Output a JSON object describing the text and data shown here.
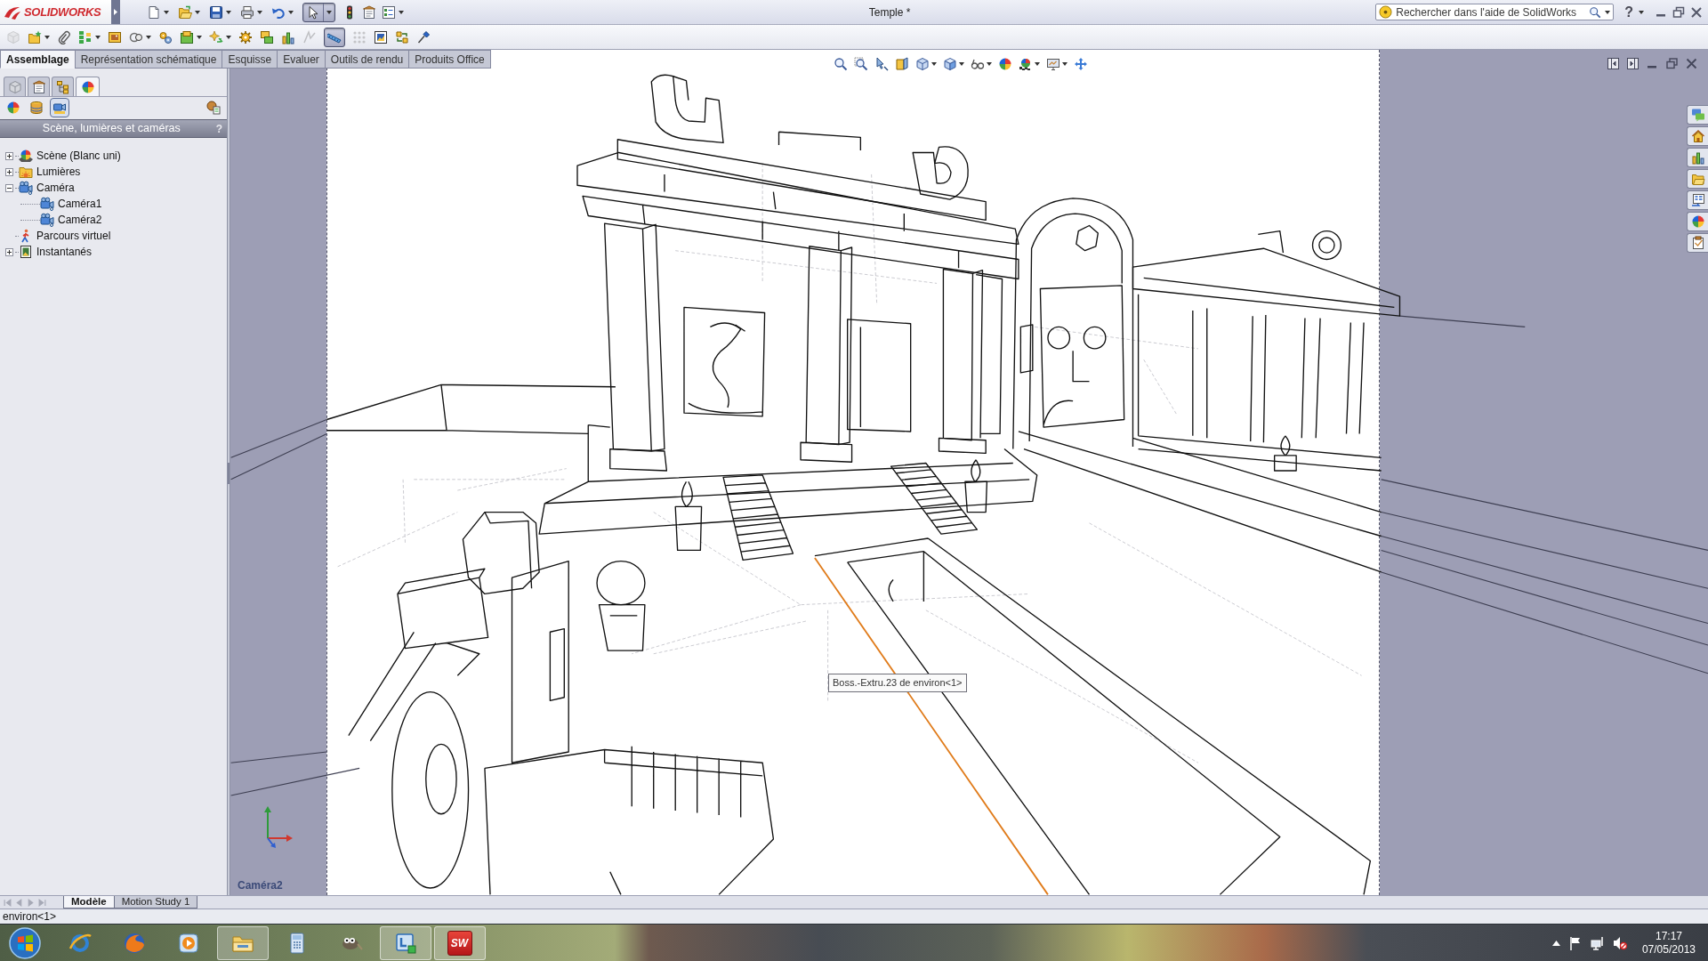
{
  "app": {
    "logo": "SOLIDWORKS",
    "title": "Temple *",
    "search": {
      "placeholder": "Rechercher dans l'aide de SolidWorks"
    },
    "help": "?"
  },
  "quick_access": [
    {
      "pressed": false
    },
    {
      "pressed": false
    },
    {
      "pressed": false
    },
    {
      "pressed": false
    },
    {
      "pressed": false
    },
    {
      "pressed": true
    },
    {
      "pressed": false
    },
    {
      "pressed": false
    },
    {
      "pressed": false
    }
  ],
  "command_toolbar": [
    {
      "disabled": true,
      "pressed": false
    },
    {
      "disabled": false,
      "pressed": false
    },
    {
      "disabled": false,
      "pressed": false
    },
    {
      "disabled": false,
      "pressed": false
    },
    {
      "disabled": false,
      "pressed": false
    },
    {
      "disabled": false,
      "pressed": false
    },
    {
      "disabled": false,
      "pressed": false
    },
    {
      "disabled": false,
      "pressed": false
    },
    {
      "disabled": false,
      "pressed": false
    },
    {
      "disabled": false,
      "pressed": false
    },
    {
      "disabled": false,
      "pressed": false
    },
    {
      "disabled": false,
      "pressed": false
    },
    {
      "disabled": true,
      "pressed": false
    },
    {
      "disabled": false,
      "pressed": true
    },
    {
      "disabled": true,
      "pressed": false
    },
    {
      "disabled": false,
      "pressed": false
    },
    {
      "disabled": false,
      "pressed": false
    },
    {
      "disabled": false,
      "pressed": false
    }
  ],
  "command_tabs": [
    {
      "label": "Assemblage",
      "selected": true
    },
    {
      "label": "Représentation schématique",
      "selected": false
    },
    {
      "label": "Esquisse",
      "selected": false
    },
    {
      "label": "Evaluer",
      "selected": false
    },
    {
      "label": "Outils de rendu",
      "selected": false
    },
    {
      "label": "Produits Office",
      "selected": false
    }
  ],
  "panel": {
    "tabs": [
      {
        "selected": false
      },
      {
        "selected": false
      },
      {
        "selected": false
      },
      {
        "selected": true
      }
    ],
    "view_buttons": [
      {
        "selected": false
      },
      {
        "selected": false
      },
      {
        "selected": true
      }
    ],
    "header": "Scène, lumières et caméras",
    "help": "?",
    "tree": [
      {
        "label": "Scène (Blanc uni)",
        "expanded": false
      },
      {
        "label": "Lumières",
        "expanded": false
      },
      {
        "label": "Caméra",
        "expanded": true,
        "children": [
          {
            "label": "Caméra1"
          },
          {
            "label": "Caméra2"
          }
        ]
      },
      {
        "label": "Parcours virtuel"
      },
      {
        "label": "Instantanés",
        "expanded": false
      }
    ]
  },
  "viewport": {
    "tooltip": "Boss.-Extru.23 de environ<1>",
    "camera_label": "Caméra2"
  },
  "bottom_tabs": [
    {
      "label": "Modèle",
      "selected": true
    },
    {
      "label": "Motion Study 1",
      "selected": false
    }
  ],
  "status_bar": {
    "text": "environ<1>"
  },
  "taskbar": {
    "apps": [
      {
        "running": false
      },
      {
        "running": false
      },
      {
        "running": false
      },
      {
        "running": true
      },
      {
        "running": false
      },
      {
        "running": false
      },
      {
        "running": true
      },
      {
        "running": true,
        "label": "SW"
      }
    ],
    "volume_muted": true,
    "time": "17:17",
    "date": "07/05/2013"
  }
}
